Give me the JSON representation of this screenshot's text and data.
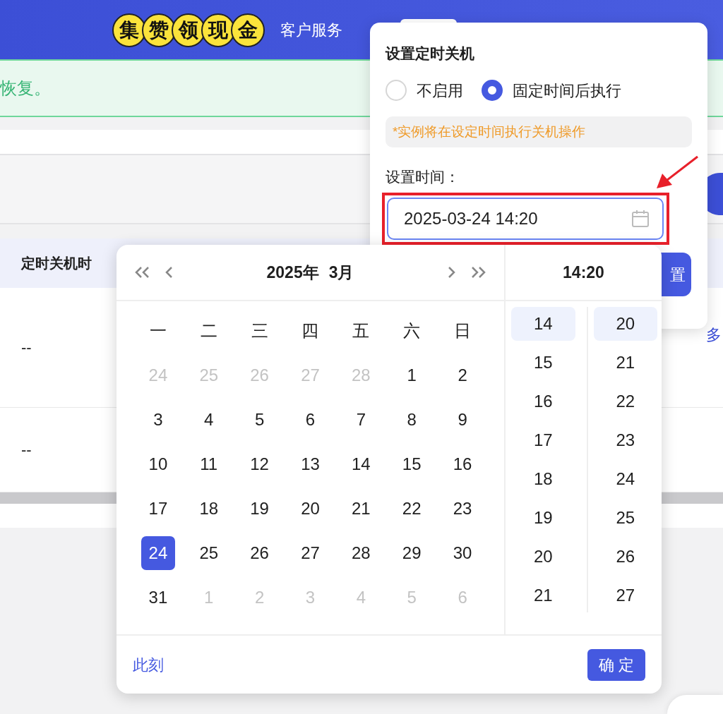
{
  "header": {
    "promo_chars": [
      "集",
      "赞",
      "领",
      "现",
      "金"
    ],
    "service_link": "客户服务"
  },
  "alert": {
    "text": "恢复。"
  },
  "table": {
    "columns": [
      "定时关机时"
    ],
    "rows": [
      [
        "--"
      ],
      [
        "--"
      ]
    ],
    "row_link": "多"
  },
  "popover": {
    "title": "设置定时关机",
    "options": [
      {
        "label": "不启用",
        "selected": false
      },
      {
        "label": "固定时间后执行",
        "selected": true
      }
    ],
    "note": "*实例将在设定时间执行关机操作",
    "time_label": "设置时间：",
    "time_value": "2025-03-24 14:20",
    "button": "置"
  },
  "calendar": {
    "year": "2025年",
    "month": "3月",
    "time_title": "14:20",
    "weekdays": [
      "一",
      "二",
      "三",
      "四",
      "五",
      "六",
      "日"
    ],
    "days": [
      {
        "label": "24",
        "in_month": false,
        "selected": false
      },
      {
        "label": "25",
        "in_month": false,
        "selected": false
      },
      {
        "label": "26",
        "in_month": false,
        "selected": false
      },
      {
        "label": "27",
        "in_month": false,
        "selected": false
      },
      {
        "label": "28",
        "in_month": false,
        "selected": false
      },
      {
        "label": "1",
        "in_month": true,
        "selected": false
      },
      {
        "label": "2",
        "in_month": true,
        "selected": false
      },
      {
        "label": "3",
        "in_month": true,
        "selected": false
      },
      {
        "label": "4",
        "in_month": true,
        "selected": false
      },
      {
        "label": "5",
        "in_month": true,
        "selected": false
      },
      {
        "label": "6",
        "in_month": true,
        "selected": false
      },
      {
        "label": "7",
        "in_month": true,
        "selected": false
      },
      {
        "label": "8",
        "in_month": true,
        "selected": false
      },
      {
        "label": "9",
        "in_month": true,
        "selected": false
      },
      {
        "label": "10",
        "in_month": true,
        "selected": false
      },
      {
        "label": "11",
        "in_month": true,
        "selected": false
      },
      {
        "label": "12",
        "in_month": true,
        "selected": false
      },
      {
        "label": "13",
        "in_month": true,
        "selected": false
      },
      {
        "label": "14",
        "in_month": true,
        "selected": false
      },
      {
        "label": "15",
        "in_month": true,
        "selected": false
      },
      {
        "label": "16",
        "in_month": true,
        "selected": false
      },
      {
        "label": "17",
        "in_month": true,
        "selected": false
      },
      {
        "label": "18",
        "in_month": true,
        "selected": false
      },
      {
        "label": "19",
        "in_month": true,
        "selected": false
      },
      {
        "label": "20",
        "in_month": true,
        "selected": false
      },
      {
        "label": "21",
        "in_month": true,
        "selected": false
      },
      {
        "label": "22",
        "in_month": true,
        "selected": false
      },
      {
        "label": "23",
        "in_month": true,
        "selected": false
      },
      {
        "label": "24",
        "in_month": true,
        "selected": true
      },
      {
        "label": "25",
        "in_month": true,
        "selected": false
      },
      {
        "label": "26",
        "in_month": true,
        "selected": false
      },
      {
        "label": "27",
        "in_month": true,
        "selected": false
      },
      {
        "label": "28",
        "in_month": true,
        "selected": false
      },
      {
        "label": "29",
        "in_month": true,
        "selected": false
      },
      {
        "label": "30",
        "in_month": true,
        "selected": false
      },
      {
        "label": "31",
        "in_month": true,
        "selected": false
      },
      {
        "label": "1",
        "in_month": false,
        "selected": false
      },
      {
        "label": "2",
        "in_month": false,
        "selected": false
      },
      {
        "label": "3",
        "in_month": false,
        "selected": false
      },
      {
        "label": "4",
        "in_month": false,
        "selected": false
      },
      {
        "label": "5",
        "in_month": false,
        "selected": false
      },
      {
        "label": "6",
        "in_month": false,
        "selected": false
      }
    ],
    "hours": [
      {
        "label": "14",
        "selected": true
      },
      {
        "label": "15",
        "selected": false
      },
      {
        "label": "16",
        "selected": false
      },
      {
        "label": "17",
        "selected": false
      },
      {
        "label": "18",
        "selected": false
      },
      {
        "label": "19",
        "selected": false
      },
      {
        "label": "20",
        "selected": false
      },
      {
        "label": "21",
        "selected": false
      }
    ],
    "minutes": [
      {
        "label": "20",
        "selected": true
      },
      {
        "label": "21",
        "selected": false
      },
      {
        "label": "22",
        "selected": false
      },
      {
        "label": "23",
        "selected": false
      },
      {
        "label": "24",
        "selected": false
      },
      {
        "label": "25",
        "selected": false
      },
      {
        "label": "26",
        "selected": false
      },
      {
        "label": "27",
        "selected": false
      }
    ],
    "now_link": "此刻",
    "ok_button": "确 定"
  }
}
